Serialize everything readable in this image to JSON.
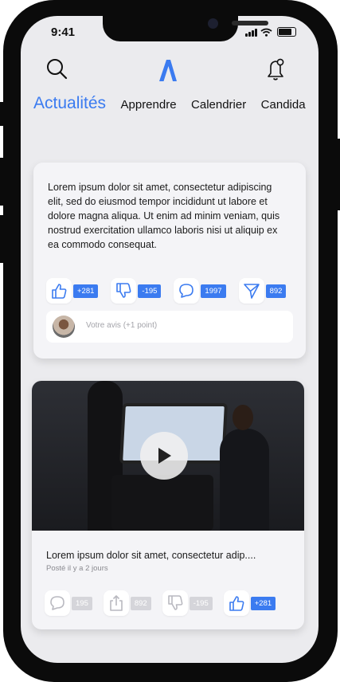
{
  "status_bar": {
    "time": "9:41"
  },
  "icons": {
    "search": "search-icon",
    "logo": "logo-icon",
    "notifications": "bell-icon",
    "like": "thumbs-up-icon",
    "dislike": "thumbs-down-icon",
    "comment": "comment-icon",
    "share": "send-icon",
    "share_alt": "share-icon",
    "play": "play-icon"
  },
  "colors": {
    "accent": "#3b7bf0",
    "background": "#ebebee",
    "card": "#f4f4f7"
  },
  "tabs": [
    {
      "label": "Actualités",
      "active": true
    },
    {
      "label": "Apprendre",
      "active": false
    },
    {
      "label": "Calendrier",
      "active": false
    },
    {
      "label": "Candida",
      "active": false
    }
  ],
  "post1": {
    "text": "Lorem ipsum dolor sit amet, consectetur adipiscing elit, sed do eiusmod tempor incididunt ut labore et dolore magna aliqua. Ut enim ad minim veniam, quis nostrud exercitation ullamco laboris nisi ut aliquip ex ea commodo consequat.",
    "likes": "+281",
    "dislikes": "-195",
    "comments": "1997",
    "shares": "892",
    "comment_placeholder": "Votre avis (+1 point)"
  },
  "post2": {
    "caption": "Lorem ipsum dolor sit amet, consectetur adip....",
    "posted": "Posté il y a 2 jours",
    "comments": "195",
    "shares": "892",
    "dislikes": "-195",
    "likes": "+281"
  }
}
